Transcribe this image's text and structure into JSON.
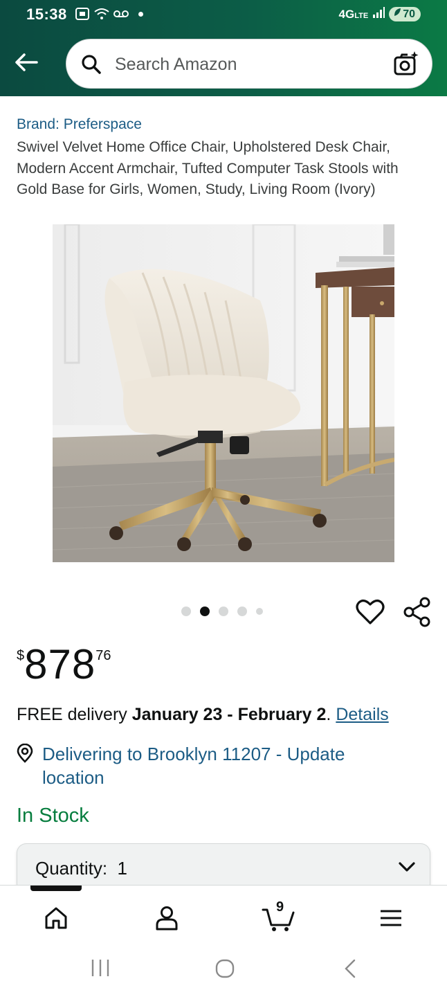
{
  "status_bar": {
    "time": "15:38",
    "network": "4G",
    "network_sub": "LTE",
    "battery": "70"
  },
  "search": {
    "placeholder": "Search Amazon"
  },
  "product": {
    "brand": "Brand: Preferspace",
    "title": "Swivel Velvet Home Office Chair, Upholstered Desk Chair, Modern Accent Armchair, Tufted Computer Task Stools with Gold Base for Girls, Women, Study, Living Room (Ivory)",
    "image_count": 5,
    "active_image": 2
  },
  "price": {
    "currency": "$",
    "whole": "878",
    "fraction": "76"
  },
  "delivery": {
    "prefix": "FREE delivery ",
    "dates": "January 23 - February 2",
    "suffix": ". ",
    "details_link": "Details"
  },
  "location": {
    "text": "Delivering to Brooklyn 11207 - Update location"
  },
  "stock": {
    "status": "In Stock"
  },
  "quantity": {
    "label": "Quantity:",
    "value": "1"
  },
  "bottom_nav": {
    "cart_count": "9"
  },
  "colors": {
    "header_start": "#0b4a40",
    "header_end": "#0b7a45",
    "link": "#1c5c85",
    "in_stock": "#067d3e"
  }
}
